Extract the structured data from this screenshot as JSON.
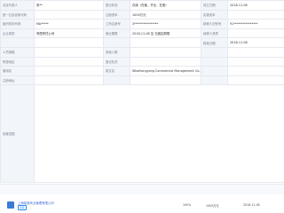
{
  "rows": [
    [
      "法定代表人",
      "张**",
      "登记状态",
      "存续（在营、开业、在册）",
      "成立日期",
      "2018-11-08"
    ],
    [
      "统一社会信用代码",
      "",
      "注册资本",
      "1000万元",
      "实缴资本",
      ""
    ],
    [
      "组织机构代码",
      "MA*****",
      "工商注册号",
      "3****************",
      "纳税人识别号",
      "91****************"
    ],
    [
      "企业类型",
      "有限责任公司",
      "营业期限",
      "2018-11-08 至 无固定期限",
      "纳税人资质",
      ""
    ],
    [
      "",
      "",
      "",
      "",
      "核准日期",
      "2018-11-08"
    ],
    [
      "人员规模",
      "",
      "参保人数",
      "",
      "",
      ""
    ],
    [
      "所属地区",
      "",
      "登记机关",
      "",
      "",
      ""
    ],
    [
      "曾用名",
      "",
      "英文名",
      "Wisehongyang Commercial Management Co., Ltd.",
      "",
      ""
    ],
    [
      "注册地址",
      "",
      "",
      "",
      "",
      ""
    ],
    [
      "经营范围",
      "",
      "",
      "",
      "",
      ""
    ]
  ],
  "bottom": {
    "company": "上海某某商业管理有限公司",
    "tag": "存续",
    "cells": [
      "100%",
      "1000万元",
      "2018-11-08"
    ]
  }
}
